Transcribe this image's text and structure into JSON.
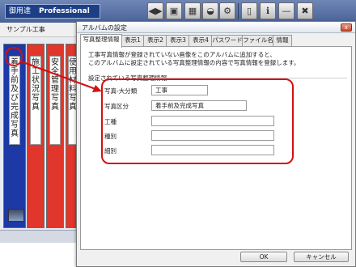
{
  "app": {
    "title": "御用達",
    "edition": "Professional",
    "project_name": "サンプル工事",
    "toolbar_icons": [
      "back-forward-icon",
      "import-photo-icon",
      "photo-settings-icon",
      "photo-export-icon",
      "gear-icon",
      "exit-door-icon",
      "info-icon",
      "minimize-icon",
      "close-icon"
    ],
    "toolbar_glyphs": [
      "◀▶",
      "▣",
      "▦",
      "◒",
      "⚙",
      "▯",
      "ℹ",
      "—",
      "✖"
    ],
    "binders": [
      {
        "label": "着手前及び完成写真",
        "color": "#1d39a6"
      },
      {
        "label": "施工状況写真",
        "color": "#e1362b"
      },
      {
        "label": "安全管理写真",
        "color": "#e1362b"
      },
      {
        "label": "使用材料写真",
        "color": "#e1362b"
      }
    ]
  },
  "dialog": {
    "title": "アルバムの設定",
    "close_glyph": "x",
    "tabs": [
      "写真整理情報",
      "表示1",
      "表示2",
      "表示3",
      "表示4",
      "パスワード",
      "ファイル名",
      "情報"
    ],
    "description_line1": "工事写真情報が登録されていない画像をこのアルバムに追加すると、",
    "description_line2": "このアルバムに設定されている写真整理情報の内容で写真情報を登録します。",
    "group_label": "設定されている写真整理情報",
    "fields": [
      {
        "label": "写真-大分類",
        "value": "工事"
      },
      {
        "label": "写真区分",
        "value": "着手前及完成写真"
      },
      {
        "label": "工種",
        "value": ""
      },
      {
        "label": "種別",
        "value": ""
      },
      {
        "label": "細別",
        "value": ""
      }
    ],
    "ok_label": "OK",
    "cancel_label": "キャンセル"
  },
  "colors": {
    "annotation_red": "#d21111",
    "title_bar_blue": "#1e3f86",
    "binder_blue": "#1d39a6",
    "binder_red": "#e1362b"
  }
}
